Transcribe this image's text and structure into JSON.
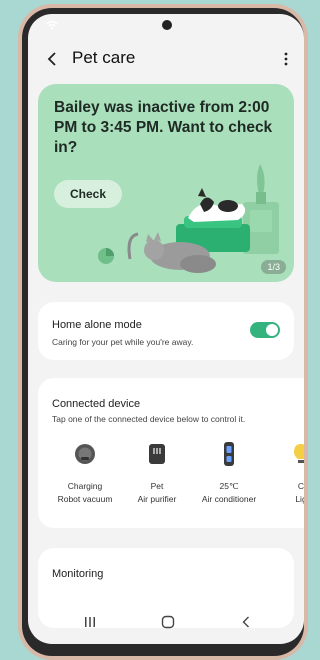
{
  "header": {
    "title": "Pet care"
  },
  "hero": {
    "message": "Bailey was inactive from 2:00 PM to 3:45 PM. Want to check in?",
    "check_label": "Check",
    "page_indicator": "1/3"
  },
  "home_alone": {
    "title": "Home alone mode",
    "subtitle": "Caring for your pet while you're away.",
    "enabled": true
  },
  "connected": {
    "title": "Connected device",
    "subtitle": "Tap one of the connected device below to control it.",
    "devices": [
      {
        "icon": "robot-vacuum-icon",
        "line1": "Charging",
        "line2": "Robot vacuum"
      },
      {
        "icon": "air-purifier-icon",
        "line1": "Pet",
        "line2": "Air purifier"
      },
      {
        "icon": "air-conditioner-icon",
        "line1": "25℃",
        "line2": "Air conditioner"
      },
      {
        "icon": "light-icon",
        "line1": "C",
        "line2": "Lig"
      }
    ]
  },
  "monitoring": {
    "title": "Monitoring"
  },
  "colors": {
    "accent": "#35b37e",
    "hero_bg": "#a9dfbb",
    "page_bg": "#a9d7d1"
  }
}
